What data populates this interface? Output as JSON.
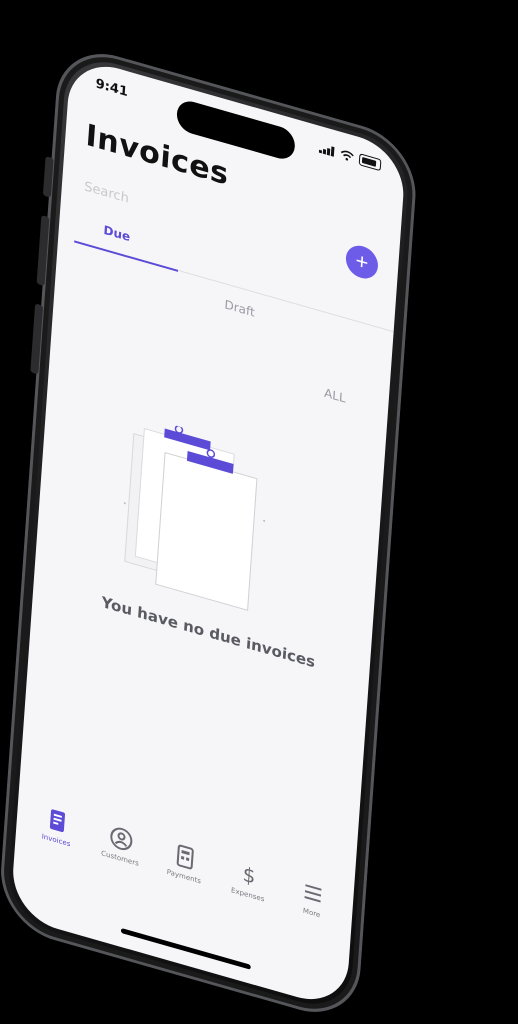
{
  "status_bar": {
    "time": "9:41"
  },
  "header": {
    "title": "Invoices"
  },
  "search": {
    "placeholder": "Search"
  },
  "tabs": [
    {
      "label": "Due",
      "active": true
    },
    {
      "label": "Draft",
      "active": false
    },
    {
      "label": "ALL",
      "active": false
    }
  ],
  "empty_state": {
    "message": "You have no due invoices"
  },
  "bottom_nav": [
    {
      "label": "Invoices",
      "icon": "invoice-icon",
      "active": true
    },
    {
      "label": "Customers",
      "icon": "customers-icon",
      "active": false
    },
    {
      "label": "Payments",
      "icon": "payments-icon",
      "active": false
    },
    {
      "label": "Expenses",
      "icon": "dollar-icon",
      "active": false
    },
    {
      "label": "More",
      "icon": "menu-icon",
      "active": false
    }
  ],
  "colors": {
    "accent": "#5b4bd6",
    "add_button": "#6c5ce7",
    "background": "#000000",
    "screen": "#f6f6f8"
  }
}
